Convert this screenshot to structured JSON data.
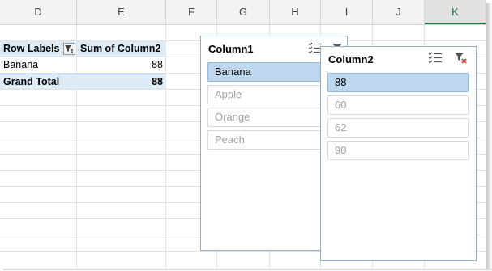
{
  "columns": [
    "D",
    "E",
    "F",
    "G",
    "H",
    "I",
    "J",
    "K"
  ],
  "pivot": {
    "header_row_labels": "Row Labels",
    "header_sum": "Sum of Column2",
    "row_label": "Banana",
    "row_value": "88",
    "total_label": "Grand Total",
    "total_value": "88"
  },
  "slicer1": {
    "title": "Column1",
    "items": [
      {
        "label": "Banana",
        "selected": true
      },
      {
        "label": "Apple",
        "selected": false
      },
      {
        "label": "Orange",
        "selected": false
      },
      {
        "label": "Peach",
        "selected": false
      }
    ]
  },
  "slicer2": {
    "title": "Column2",
    "items": [
      {
        "label": "88",
        "selected": true
      },
      {
        "label": "60",
        "selected": false
      },
      {
        "label": "62",
        "selected": false
      },
      {
        "label": "90",
        "selected": false
      }
    ]
  },
  "icons": {
    "multi_select": "multi-select-icon",
    "clear_filter": "clear-filter-icon",
    "filter_dropdown": "filter-dropdown-icon"
  },
  "colors": {
    "pivot_header_bg": "#ddebf7",
    "slicer_selected_bg": "#bdd7ee",
    "clear_filter_red": "#e03a2e",
    "selected_column_green": "#217346"
  }
}
